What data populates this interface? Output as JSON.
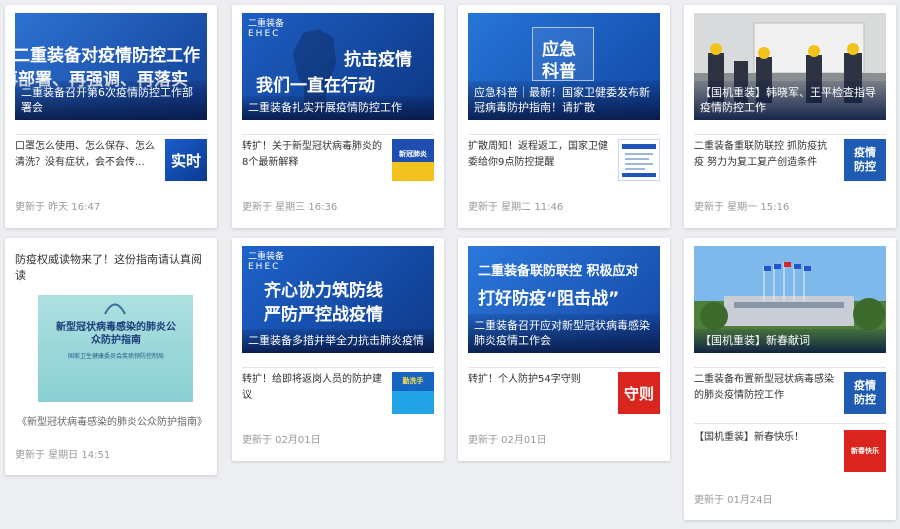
{
  "cards": [
    {
      "cover": {
        "big_text_1": "二重装备对疫情防控工作",
        "big_text_2": "再部署、再强调、再落实",
        "caption": "二重装备召开第6次疫情防控工作部署会"
      },
      "items": [
        {
          "text": "口罩怎么使用、怎么保存、怎么清洗？没有症状，会不会传...",
          "thumb_text": "实时"
        }
      ],
      "updated": "更新于 昨天 16:47"
    },
    {
      "cover": {
        "logo": "二重装备",
        "logo_sub": "EHEC",
        "big_text_1": "抗击疫情",
        "big_text_2": "我们一直在行动",
        "caption": "二重装备扎实开展疫情防控工作"
      },
      "items": [
        {
          "text": "转扩！关于新型冠状病毒肺炎的8个最新解释",
          "thumb_text": "新冠肺炎"
        }
      ],
      "updated": "更新于 星期三 16:36"
    },
    {
      "cover": {
        "big_text_1": "应急",
        "big_text_2": "科普",
        "caption": "应急科普｜最新！国家卫健委发布新冠病毒防护指南！请扩散"
      },
      "items": [
        {
          "text": "扩散周知！返程返工，国家卫健委给你9点防控提醒",
          "thumb_text": ""
        }
      ],
      "updated": "更新于 星期二 11:46"
    },
    {
      "cover": {
        "caption": "【国机重装】韩晓军、王平检查指导疫情防控工作"
      },
      "items": [
        {
          "text": "二重装备重联防联控 抓防疫抗疫 努力为复工复产创造条件",
          "thumb_text": "疫情防控"
        }
      ],
      "updated": "更新于 星期一 15:16"
    },
    {
      "title": "防疫权威读物来了！这份指南请认真阅读",
      "book": {
        "title": "新型冠状病毒感染的肺炎公众防护指南",
        "publisher": "国家卫生健康委员会疾病预防控制局"
      },
      "caption": "《新型冠状病毒感染的肺炎公众防护指南》",
      "updated": "更新于 星期日 14:51"
    },
    {
      "cover": {
        "logo": "二重装备",
        "logo_sub": "EHEC",
        "big_text_1": "齐心协力筑防线",
        "big_text_2": "严防严控战疫情",
        "caption": "二重装备多措并举全力抗击肺炎疫情"
      },
      "items": [
        {
          "text": "转扩！给即将返岗人员的防护建议",
          "thumb_text": "勤洗手"
        }
      ],
      "updated": "更新于 02月01日"
    },
    {
      "cover": {
        "big_text_1": "二重装备联防联控 积极应对",
        "big_text_2": "打好防疫“阻击战”",
        "caption": "二重装备召开应对新型冠状病毒感染肺炎疫情工作会"
      },
      "items": [
        {
          "text": "转扩！个人防护54字守则",
          "thumb_text": "守则"
        }
      ],
      "updated": "更新于 02月01日"
    },
    {
      "cover": {
        "caption": "【国机重装】新春献词"
      },
      "items": [
        {
          "text": "二重装备布置新型冠状病毒感染的肺炎疫情防控工作",
          "thumb_text": "疫情防控"
        },
        {
          "text": "【国机重装】新春快乐！",
          "thumb_text": "新春快乐"
        }
      ],
      "updated": "更新于 01月24日"
    }
  ],
  "colors": {
    "brand_blue": "#1d56b8",
    "deep_blue": "#0f3c8c",
    "red": "#d9251d"
  }
}
